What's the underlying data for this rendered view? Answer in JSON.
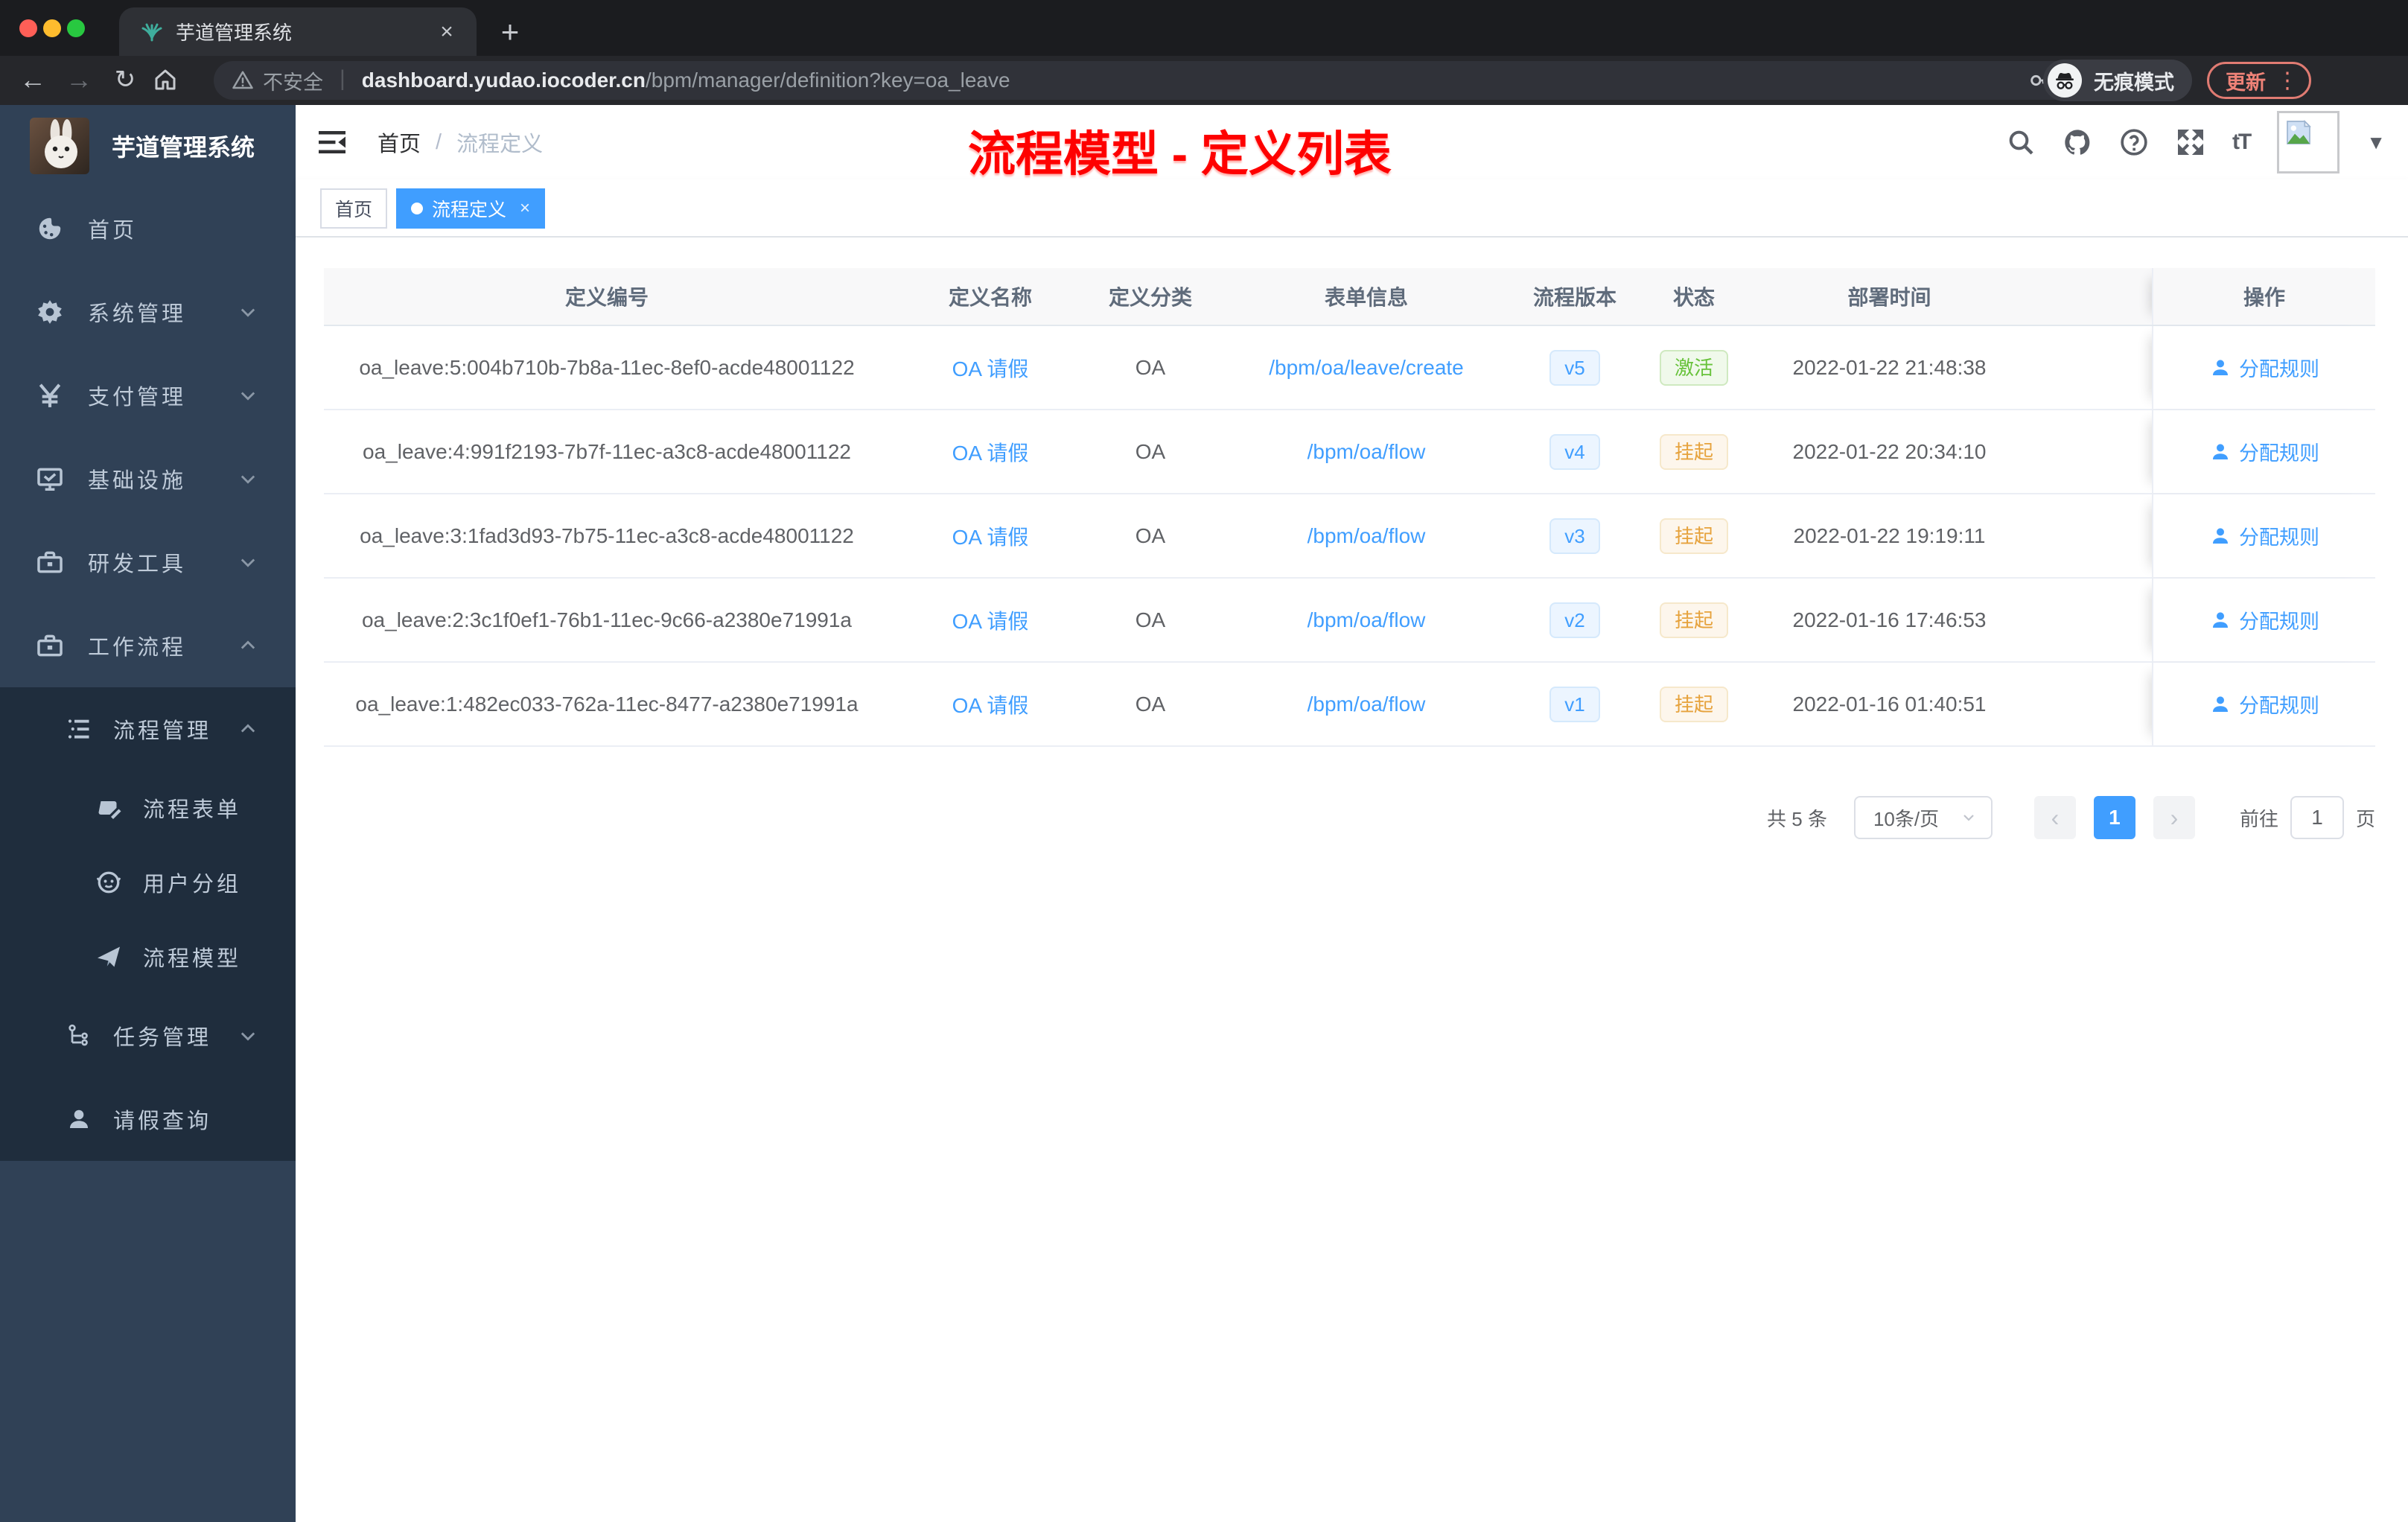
{
  "glyphs": {
    "close": "×",
    "plus": "+",
    "back": "←",
    "forward": "→",
    "reload": "↻",
    "star": "☆",
    "separator": "|",
    "menu_dots": "⋮",
    "caret_down": "▼",
    "prev": "‹",
    "next": "›"
  },
  "colors": {
    "accent": "#409eff",
    "success": "#67c23a",
    "warning": "#e6a23c",
    "annotation_red": "#fe0100",
    "sidebar_bg": "#304156",
    "submenu_bg": "#1f2d3d"
  },
  "browser": {
    "tab_title": "芋道管理系统",
    "security_label": "不安全",
    "url_host": "dashboard.yudao.iocoder.cn",
    "url_path": "/bpm/manager/definition?key=oa_leave",
    "incognito_label": "无痕模式",
    "update_label": "更新"
  },
  "sidebar": {
    "brand": "芋道管理系统",
    "menu": [
      {
        "label": "首页"
      },
      {
        "label": "系统管理"
      },
      {
        "label": "支付管理"
      },
      {
        "label": "基础设施"
      },
      {
        "label": "研发工具"
      },
      {
        "label": "工作流程"
      }
    ],
    "submenu": [
      {
        "label": "流程管理"
      },
      {
        "label": "流程表单"
      },
      {
        "label": "用户分组"
      },
      {
        "label": "流程模型"
      },
      {
        "label": "任务管理"
      },
      {
        "label": "请假查询"
      }
    ]
  },
  "navbar": {
    "breadcrumb_home": "首页",
    "breadcrumb_sep": "/",
    "breadcrumb_current": "流程定义",
    "font_size_icon_label": "tT"
  },
  "annotation": {
    "text": "流程模型 - 定义列表"
  },
  "tags": {
    "home": "首页",
    "active": "流程定义"
  },
  "table": {
    "columns": [
      "定义编号",
      "定义名称",
      "定义分类",
      "表单信息",
      "流程版本",
      "状态",
      "部署时间",
      "操作"
    ],
    "rows": [
      {
        "id": "oa_leave:5:004b710b-7b8a-11ec-8ef0-acde48001122",
        "name": "OA 请假",
        "category": "OA",
        "form": "/bpm/oa/leave/create",
        "version": "v5",
        "status": "激活",
        "time": "2022-01-22 21:48:38",
        "action": "分配规则"
      },
      {
        "id": "oa_leave:4:991f2193-7b7f-11ec-a3c8-acde48001122",
        "name": "OA 请假",
        "category": "OA",
        "form": "/bpm/oa/flow",
        "version": "v4",
        "status": "挂起",
        "time": "2022-01-22 20:34:10",
        "action": "分配规则"
      },
      {
        "id": "oa_leave:3:1fad3d93-7b75-11ec-a3c8-acde48001122",
        "name": "OA 请假",
        "category": "OA",
        "form": "/bpm/oa/flow",
        "version": "v3",
        "status": "挂起",
        "time": "2022-01-22 19:19:11",
        "action": "分配规则"
      },
      {
        "id": "oa_leave:2:3c1f0ef1-76b1-11ec-9c66-a2380e71991a",
        "name": "OA 请假",
        "category": "OA",
        "form": "/bpm/oa/flow",
        "version": "v2",
        "status": "挂起",
        "time": "2022-01-16 17:46:53",
        "action": "分配规则"
      },
      {
        "id": "oa_leave:1:482ec033-762a-11ec-8477-a2380e71991a",
        "name": "OA 请假",
        "category": "OA",
        "form": "/bpm/oa/flow",
        "version": "v1",
        "status": "挂起",
        "time": "2022-01-16 01:40:51",
        "action": "分配规则"
      }
    ]
  },
  "pagination": {
    "total": "共 5 条",
    "page_size": "10条/页",
    "current": "1",
    "goto": "前往",
    "page_unit": "页",
    "goto_value": "1"
  }
}
